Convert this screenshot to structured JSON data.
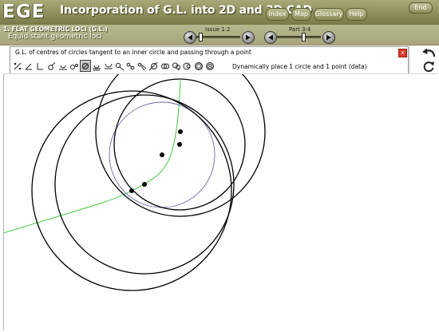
{
  "app": {
    "logo": "EGE",
    "title": "Incorporation of G.L. into 2D and 3D CAD"
  },
  "nav": {
    "index": "Index",
    "map": "Map",
    "glossary": "Glossary",
    "help": "Help",
    "end": "End"
  },
  "breadcrumb": {
    "section": "1. FLAT GEOMETRIC LOCI (G.L.)",
    "subsection": "Equidistant geometric loci"
  },
  "issue_nav": {
    "label": "Issue 1:2",
    "position": 0.05
  },
  "part_nav": {
    "label": "Part 3:4",
    "position": 0.62
  },
  "panel": {
    "title": "G.L. of centres of circles tangent to an inner circle and passing through a point",
    "close": "x",
    "status": "Dynamically place 1 circle and 1 point (data)"
  },
  "toolbar": {
    "active_index": 6,
    "tools": [
      "point-tool-icon",
      "angle-tool-icon",
      "perpendicular-tool-icon",
      "point-circle-tool-icon",
      "tangent-line-tool-icon",
      "two-circle-point-tool-icon",
      "circle-point-tool-icon",
      "circle-on-line-tool-icon",
      "line-tangent-tool-icon",
      "two-point-tool-icon",
      "points-chain-tool-icon",
      "circle-lines-tool-icon",
      "circle-line-tool-icon",
      "two-circles-tool-icon",
      "circles-point-tool-icon",
      "concentric-tool-icon",
      "inner-circle-tool-icon",
      "nested-circles-tool-icon"
    ]
  },
  "side_icons": [
    "undo-icon",
    "refresh-icon"
  ],
  "colors": {
    "titlebar": "#8e8e5c",
    "locus_curve": "#3cc83c",
    "data_circle": "#6a6ab0",
    "tangent_circles": "#000000",
    "points": "#000000"
  }
}
